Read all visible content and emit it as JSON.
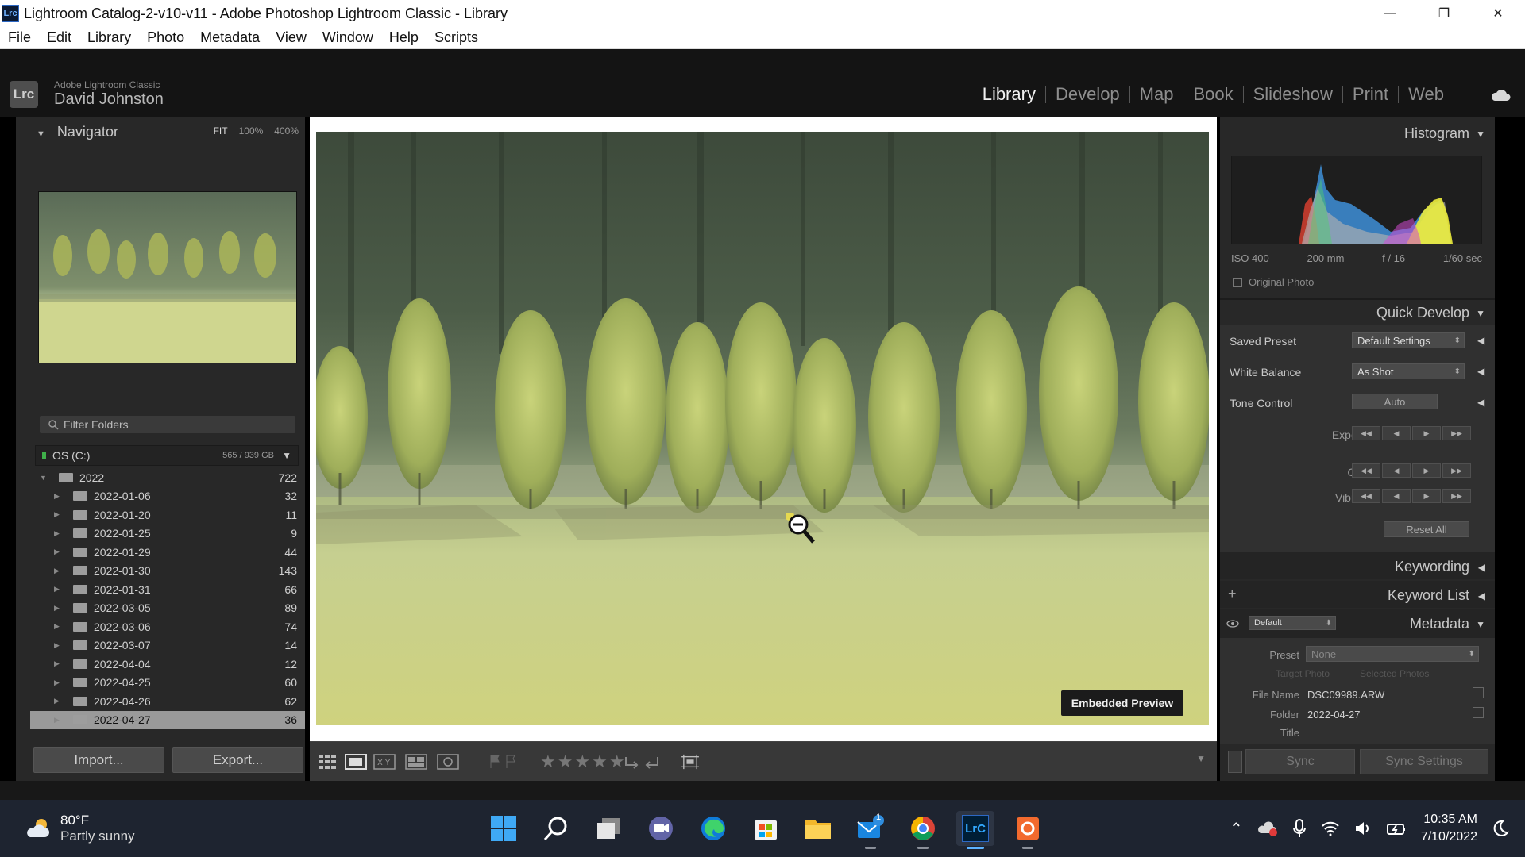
{
  "window": {
    "title": "Lightroom Catalog-2-v10-v11 - Adobe Photoshop Lightroom Classic - Library",
    "app_icon": "Lrc",
    "controls": [
      "—",
      "❐",
      "✕"
    ]
  },
  "menu": [
    "File",
    "Edit",
    "Library",
    "Photo",
    "Metadata",
    "View",
    "Window",
    "Help",
    "Scripts"
  ],
  "header": {
    "logo": "Lrc",
    "brand": "Adobe Lightroom Classic",
    "user": "David Johnston",
    "modules": [
      {
        "label": "Library",
        "active": true
      },
      {
        "label": "Develop"
      },
      {
        "label": "Map"
      },
      {
        "label": "Book"
      },
      {
        "label": "Slideshow"
      },
      {
        "label": "Print"
      },
      {
        "label": "Web"
      }
    ]
  },
  "navigator": {
    "title": "Navigator",
    "zoom": [
      "FIT",
      "100%",
      "400%"
    ]
  },
  "folders": {
    "filter_placeholder": "Filter Folders",
    "volume": {
      "name": "OS (C:)",
      "usage": "565 / 939 GB"
    },
    "root": {
      "name": "2022",
      "count": "722"
    },
    "items": [
      {
        "name": "2022-01-06",
        "count": "32"
      },
      {
        "name": "2022-01-20",
        "count": "11"
      },
      {
        "name": "2022-01-25",
        "count": "9"
      },
      {
        "name": "2022-01-29",
        "count": "44"
      },
      {
        "name": "2022-01-30",
        "count": "143"
      },
      {
        "name": "2022-01-31",
        "count": "66"
      },
      {
        "name": "2022-03-05",
        "count": "89"
      },
      {
        "name": "2022-03-06",
        "count": "74"
      },
      {
        "name": "2022-03-07",
        "count": "14"
      },
      {
        "name": "2022-04-04",
        "count": "12"
      },
      {
        "name": "2022-04-25",
        "count": "60"
      },
      {
        "name": "2022-04-26",
        "count": "62"
      },
      {
        "name": "2022-04-27",
        "count": "36",
        "selected": true
      }
    ]
  },
  "left_buttons": {
    "import": "Import...",
    "export": "Export..."
  },
  "preview": {
    "badge": "Embedded Preview"
  },
  "toolbar": {
    "stars": "★★★★★"
  },
  "histogram": {
    "title": "Histogram",
    "iso": "ISO 400",
    "focal": "200 mm",
    "aperture": "f / 16",
    "shutter": "1/60 sec",
    "original_photo": "Original Photo"
  },
  "quick_develop": {
    "title": "Quick Develop",
    "saved_preset_label": "Saved Preset",
    "saved_preset_value": "Default Settings",
    "white_balance_label": "White Balance",
    "white_balance_value": "As Shot",
    "tone_control_label": "Tone Control",
    "auto": "Auto",
    "exposure": "Exposure",
    "clarity": "Clarity",
    "vibrance": "Vibrance",
    "reset_all": "Reset All"
  },
  "keywording": {
    "title": "Keywording"
  },
  "keyword_list": {
    "title": "Keyword List"
  },
  "metadata": {
    "title": "Metadata",
    "set": "Default",
    "preset_label": "Preset",
    "preset_value": "None",
    "target_photo": "Target Photo",
    "selected_photos": "Selected Photos",
    "file_name_label": "File Name",
    "file_name_value": "DSC09989.ARW",
    "folder_label": "Folder",
    "folder_value": "2022-04-27",
    "title_label": "Title"
  },
  "sync": {
    "sync": "Sync",
    "sync_settings": "Sync Settings"
  },
  "taskbar": {
    "temp": "80°F",
    "condition": "Partly sunny",
    "time": "10:35 AM",
    "date": "7/10/2022",
    "mail_badge": "1"
  }
}
